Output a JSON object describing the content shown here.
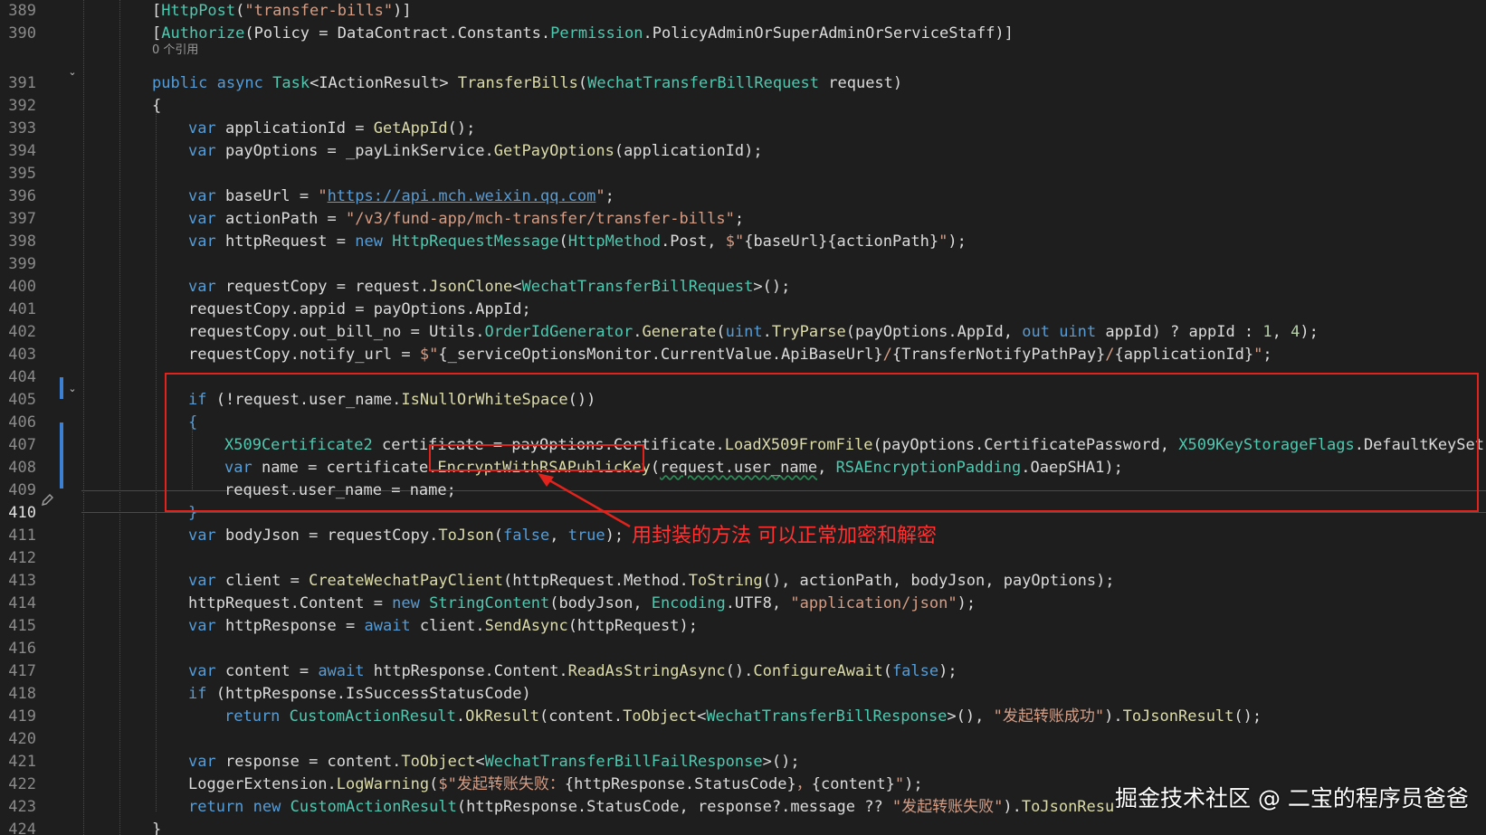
{
  "editor": {
    "reference_lens": "0 个引用",
    "active_line": 410
  },
  "lines": [
    {
      "n": 389,
      "indent": 0,
      "tokens": [
        [
          "pl",
          "["
        ],
        [
          "ty",
          "HttpPost"
        ],
        [
          "pl",
          "("
        ],
        [
          "st",
          "\"transfer-bills\""
        ],
        [
          "pl",
          ")]"
        ]
      ]
    },
    {
      "n": 390,
      "indent": 0,
      "tokens": [
        [
          "pl",
          "["
        ],
        [
          "ty",
          "Authorize"
        ],
        [
          "pl",
          "(Policy = DataContract.Constants."
        ],
        [
          "ty",
          "Permission"
        ],
        [
          "pl",
          ".PolicyAdminOrSuperAdminOrServiceStaff)]"
        ]
      ]
    },
    {
      "n": 391,
      "indent": 0,
      "tokens": [
        [
          "kw",
          "public"
        ],
        [
          "pl",
          " "
        ],
        [
          "kw",
          "async"
        ],
        [
          "pl",
          " "
        ],
        [
          "ty",
          "Task"
        ],
        [
          "pl",
          "<IActionResult> "
        ],
        [
          "fn",
          "TransferBills"
        ],
        [
          "pl",
          "("
        ],
        [
          "ty",
          "WechatTransferBillRequest"
        ],
        [
          "pl",
          " request)"
        ]
      ]
    },
    {
      "n": 392,
      "indent": 0,
      "tokens": [
        [
          "pl",
          "{"
        ]
      ]
    },
    {
      "n": 393,
      "indent": 1,
      "tokens": [
        [
          "kw",
          "var"
        ],
        [
          "pl",
          " applicationId = "
        ],
        [
          "fn",
          "GetAppId"
        ],
        [
          "pl",
          "();"
        ]
      ]
    },
    {
      "n": 394,
      "indent": 1,
      "tokens": [
        [
          "kw",
          "var"
        ],
        [
          "pl",
          " payOptions = _payLinkService."
        ],
        [
          "fn",
          "GetPayOptions"
        ],
        [
          "pl",
          "(applicationId);"
        ]
      ]
    },
    {
      "n": 395,
      "indent": 1,
      "tokens": []
    },
    {
      "n": 396,
      "indent": 1,
      "tokens": [
        [
          "kw",
          "var"
        ],
        [
          "pl",
          " baseUrl = "
        ],
        [
          "st",
          "\""
        ],
        [
          "lk",
          "https://api.mch.weixin.qq.com"
        ],
        [
          "st",
          "\""
        ],
        [
          "pl",
          ";"
        ]
      ]
    },
    {
      "n": 397,
      "indent": 1,
      "tokens": [
        [
          "kw",
          "var"
        ],
        [
          "pl",
          " actionPath = "
        ],
        [
          "st",
          "\"/v3/fund-app/mch-transfer/transfer-bills\""
        ],
        [
          "pl",
          ";"
        ]
      ]
    },
    {
      "n": 398,
      "indent": 1,
      "tokens": [
        [
          "kw",
          "var"
        ],
        [
          "pl",
          " httpRequest = "
        ],
        [
          "kw",
          "new"
        ],
        [
          "pl",
          " "
        ],
        [
          "ty",
          "HttpRequestMessage"
        ],
        [
          "pl",
          "("
        ],
        [
          "ty",
          "HttpMethod"
        ],
        [
          "pl",
          ".Post, "
        ],
        [
          "st",
          "$\""
        ],
        [
          "pl",
          "{baseUrl}{actionPath}"
        ],
        [
          "st",
          "\""
        ],
        [
          "pl",
          ");"
        ]
      ]
    },
    {
      "n": 399,
      "indent": 1,
      "tokens": []
    },
    {
      "n": 400,
      "indent": 1,
      "tokens": [
        [
          "kw",
          "var"
        ],
        [
          "pl",
          " requestCopy = request."
        ],
        [
          "fn",
          "JsonClone"
        ],
        [
          "pl",
          "<"
        ],
        [
          "ty",
          "WechatTransferBillRequest"
        ],
        [
          "pl",
          ">();"
        ]
      ]
    },
    {
      "n": 401,
      "indent": 1,
      "tokens": [
        [
          "pl",
          "requestCopy.appid = payOptions.AppId;"
        ]
      ]
    },
    {
      "n": 402,
      "indent": 1,
      "tokens": [
        [
          "pl",
          "requestCopy.out_bill_no = Utils."
        ],
        [
          "ty",
          "OrderIdGenerator"
        ],
        [
          "pl",
          "."
        ],
        [
          "fn",
          "Generate"
        ],
        [
          "pl",
          "("
        ],
        [
          "kw",
          "uint"
        ],
        [
          "pl",
          "."
        ],
        [
          "fn",
          "TryParse"
        ],
        [
          "pl",
          "(payOptions.AppId, "
        ],
        [
          "kw",
          "out"
        ],
        [
          "pl",
          " "
        ],
        [
          "kw",
          "uint"
        ],
        [
          "pl",
          " appId) ? appId : "
        ],
        [
          "nu",
          "1"
        ],
        [
          "pl",
          ", "
        ],
        [
          "nu",
          "4"
        ],
        [
          "pl",
          ");"
        ]
      ]
    },
    {
      "n": 403,
      "indent": 1,
      "tokens": [
        [
          "pl",
          "requestCopy.notify_url = "
        ],
        [
          "st",
          "$\""
        ],
        [
          "pl",
          "{_serviceOptionsMonitor.CurrentValue.ApiBaseUrl}"
        ],
        [
          "st",
          "/"
        ],
        [
          "pl",
          "{TransferNotifyPathPay}"
        ],
        [
          "st",
          "/"
        ],
        [
          "pl",
          "{applicationId}"
        ],
        [
          "st",
          "\""
        ],
        [
          "pl",
          ";"
        ]
      ]
    },
    {
      "n": 404,
      "indent": 1,
      "tokens": []
    },
    {
      "n": 405,
      "indent": 1,
      "tokens": [
        [
          "kw",
          "if"
        ],
        [
          "pl",
          " (!request.user_name."
        ],
        [
          "fn",
          "IsNullOrWhiteSpace"
        ],
        [
          "pl",
          "())"
        ]
      ]
    },
    {
      "n": 406,
      "indent": 1,
      "tokens": [
        [
          "kw",
          "{"
        ]
      ]
    },
    {
      "n": 407,
      "indent": 2,
      "tokens": [
        [
          "ty",
          "X509Certificate2"
        ],
        [
          "pl",
          " certificate = payOptions.Certificate."
        ],
        [
          "fn",
          "LoadX509FromFile"
        ],
        [
          "pl",
          "(payOptions.CertificatePassword, "
        ],
        [
          "ty",
          "X509KeyStorageFlags"
        ],
        [
          "pl",
          ".DefaultKeySet);"
        ]
      ]
    },
    {
      "n": 408,
      "indent": 2,
      "tokens": [
        [
          "kw",
          "var"
        ],
        [
          "pl",
          " name = certificate."
        ],
        [
          "fn",
          "EncryptWithRSAPublicKey"
        ],
        [
          "pl",
          "("
        ],
        [
          "sq",
          "request.user_name"
        ],
        [
          "pl",
          ", "
        ],
        [
          "ty",
          "RSAEncryptionPadding"
        ],
        [
          "pl",
          ".OaepSHA1);"
        ]
      ]
    },
    {
      "n": 409,
      "indent": 2,
      "tokens": [
        [
          "pl",
          "request.user_name = name;"
        ]
      ]
    },
    {
      "n": 410,
      "indent": 1,
      "tokens": [
        [
          "kw",
          "}"
        ]
      ]
    },
    {
      "n": 411,
      "indent": 1,
      "tokens": [
        [
          "kw",
          "var"
        ],
        [
          "pl",
          " bodyJson = requestCopy."
        ],
        [
          "fn",
          "ToJson"
        ],
        [
          "pl",
          "("
        ],
        [
          "kw",
          "false"
        ],
        [
          "pl",
          ", "
        ],
        [
          "kw",
          "true"
        ],
        [
          "pl",
          ");"
        ]
      ]
    },
    {
      "n": 412,
      "indent": 1,
      "tokens": []
    },
    {
      "n": 413,
      "indent": 1,
      "tokens": [
        [
          "kw",
          "var"
        ],
        [
          "pl",
          " client = "
        ],
        [
          "fn",
          "CreateWechatPayClient"
        ],
        [
          "pl",
          "(httpRequest.Method."
        ],
        [
          "fn",
          "ToString"
        ],
        [
          "pl",
          "(), actionPath, bodyJson, payOptions);"
        ]
      ]
    },
    {
      "n": 414,
      "indent": 1,
      "tokens": [
        [
          "pl",
          "httpRequest.Content = "
        ],
        [
          "kw",
          "new"
        ],
        [
          "pl",
          " "
        ],
        [
          "ty",
          "StringContent"
        ],
        [
          "pl",
          "(bodyJson, "
        ],
        [
          "ty",
          "Encoding"
        ],
        [
          "pl",
          ".UTF8, "
        ],
        [
          "st",
          "\"application/json\""
        ],
        [
          "pl",
          ");"
        ]
      ]
    },
    {
      "n": 415,
      "indent": 1,
      "tokens": [
        [
          "kw",
          "var"
        ],
        [
          "pl",
          " httpResponse = "
        ],
        [
          "kw",
          "await"
        ],
        [
          "pl",
          " client."
        ],
        [
          "fn",
          "SendAsync"
        ],
        [
          "pl",
          "(httpRequest);"
        ]
      ]
    },
    {
      "n": 416,
      "indent": 1,
      "tokens": []
    },
    {
      "n": 417,
      "indent": 1,
      "tokens": [
        [
          "kw",
          "var"
        ],
        [
          "pl",
          " content = "
        ],
        [
          "kw",
          "await"
        ],
        [
          "pl",
          " httpResponse.Content."
        ],
        [
          "fn",
          "ReadAsStringAsync"
        ],
        [
          "pl",
          "()."
        ],
        [
          "fn",
          "ConfigureAwait"
        ],
        [
          "pl",
          "("
        ],
        [
          "kw",
          "false"
        ],
        [
          "pl",
          ");"
        ]
      ]
    },
    {
      "n": 418,
      "indent": 1,
      "tokens": [
        [
          "kw",
          "if"
        ],
        [
          "pl",
          " (httpResponse.IsSuccessStatusCode)"
        ]
      ]
    },
    {
      "n": 419,
      "indent": 2,
      "tokens": [
        [
          "kw",
          "return"
        ],
        [
          "pl",
          " "
        ],
        [
          "ty",
          "CustomActionResult"
        ],
        [
          "pl",
          "."
        ],
        [
          "fn",
          "OkResult"
        ],
        [
          "pl",
          "(content."
        ],
        [
          "fn",
          "ToObject"
        ],
        [
          "pl",
          "<"
        ],
        [
          "ty",
          "WechatTransferBillResponse"
        ],
        [
          "pl",
          ">(), "
        ],
        [
          "st",
          "\"发起转账成功\""
        ],
        [
          "pl",
          ")."
        ],
        [
          "fn",
          "ToJsonResult"
        ],
        [
          "pl",
          "();"
        ]
      ]
    },
    {
      "n": 420,
      "indent": 1,
      "tokens": []
    },
    {
      "n": 421,
      "indent": 1,
      "tokens": [
        [
          "kw",
          "var"
        ],
        [
          "pl",
          " response = content."
        ],
        [
          "fn",
          "ToObject"
        ],
        [
          "pl",
          "<"
        ],
        [
          "ty",
          "WechatTransferBillFailResponse"
        ],
        [
          "pl",
          ">();"
        ]
      ]
    },
    {
      "n": 422,
      "indent": 1,
      "tokens": [
        [
          "pl",
          "LoggerExtension."
        ],
        [
          "fn",
          "LogWarning"
        ],
        [
          "pl",
          "("
        ],
        [
          "st",
          "$\"发起转账失败："
        ],
        [
          "pl",
          "{httpResponse.StatusCode}"
        ],
        [
          "st",
          "，"
        ],
        [
          "pl",
          "{content}"
        ],
        [
          "st",
          "\""
        ],
        [
          "pl",
          ");"
        ]
      ]
    },
    {
      "n": 423,
      "indent": 1,
      "tokens": [
        [
          "kw",
          "return"
        ],
        [
          "pl",
          " "
        ],
        [
          "kw",
          "new"
        ],
        [
          "pl",
          " "
        ],
        [
          "ty",
          "CustomActionResult"
        ],
        [
          "pl",
          "(httpResponse.StatusCode, response?.message ?? "
        ],
        [
          "st",
          "\"发起转账失败\""
        ],
        [
          "pl",
          ")."
        ],
        [
          "fn",
          "ToJsonResu"
        ]
      ]
    },
    {
      "n": 424,
      "indent": 0,
      "tokens": [
        [
          "pl",
          "}"
        ]
      ]
    }
  ],
  "annotation": {
    "note": "用封装的方法 可以正常加密和解密"
  },
  "watermark": "掘金技术社区 @ 二宝的程序员爸爸",
  "colors": {
    "background": "#1e1e1e",
    "keyword": "#569cd6",
    "type": "#4ec9b0",
    "method": "#dcdcaa",
    "string": "#d69d85",
    "annotation_red": "#e0231c"
  },
  "icons": {
    "fold_marker": "chevron-down-icon",
    "edit_marker": "pencil-icon"
  }
}
